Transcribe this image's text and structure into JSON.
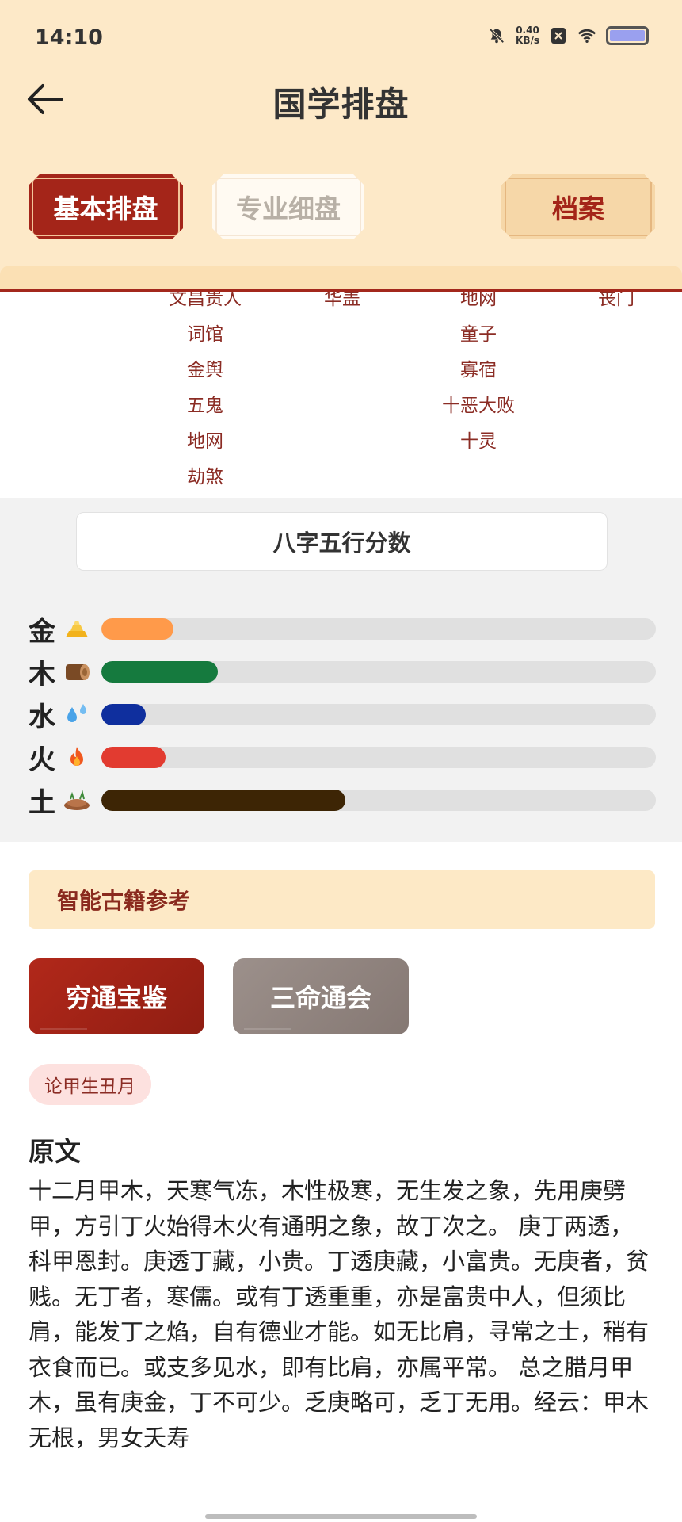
{
  "status": {
    "time": "14:10",
    "net_speed_value": "0.40",
    "net_speed_unit": "KB/s"
  },
  "header": {
    "title": "国学排盘",
    "tabs": {
      "basic": "基本排盘",
      "pro": "专业细盘",
      "archive": "档案"
    }
  },
  "shensha": {
    "col1": [
      "文昌贵人",
      "词馆",
      "金舆",
      "五鬼",
      "地网",
      "劫煞"
    ],
    "col2": [
      "华盖"
    ],
    "col3": [
      "地网",
      "童子",
      "寡宿",
      "十恶大败",
      "十灵"
    ],
    "col4": [
      "丧门"
    ]
  },
  "wuxing": {
    "title": "八字五行分数",
    "items": [
      {
        "char": "金",
        "icon": "gold-ingot-icon",
        "color": "#ff9a4a",
        "fraction": 0.13
      },
      {
        "char": "木",
        "icon": "wood-log-icon",
        "color": "#157a3e",
        "fraction": 0.21
      },
      {
        "char": "水",
        "icon": "water-drop-icon",
        "color": "#0f2f9e",
        "fraction": 0.08
      },
      {
        "char": "火",
        "icon": "fire-icon",
        "color": "#e23b30",
        "fraction": 0.115
      },
      {
        "char": "土",
        "icon": "earth-icon",
        "color": "#3d2505",
        "fraction": 0.44
      }
    ]
  },
  "reference": {
    "header": "智能古籍参考",
    "books": [
      "穷通宝鉴",
      "三命通会"
    ],
    "chip": "论甲生丑月",
    "section_label": "原文",
    "text": "十二月甲木，天寒气冻，木性极寒，无生发之象，先用庚劈甲，方引丁火始得木火有通明之象，故丁次之。 庚丁两透，科甲恩封。庚透丁藏，小贵。丁透庚藏，小富贵。无庚者，贫贱。无丁者，寒儒。或有丁透重重，亦是富贵中人，但须比肩，能发丁之焰，自有德业才能。如无比肩，寻常之士，稍有衣食而已。或支多见水，即有比肩，亦属平常。 总之腊月甲木，虽有庚金，丁不可少。乏庚略可，乏丁无用。经云：甲木无根，男女夭寿"
  }
}
